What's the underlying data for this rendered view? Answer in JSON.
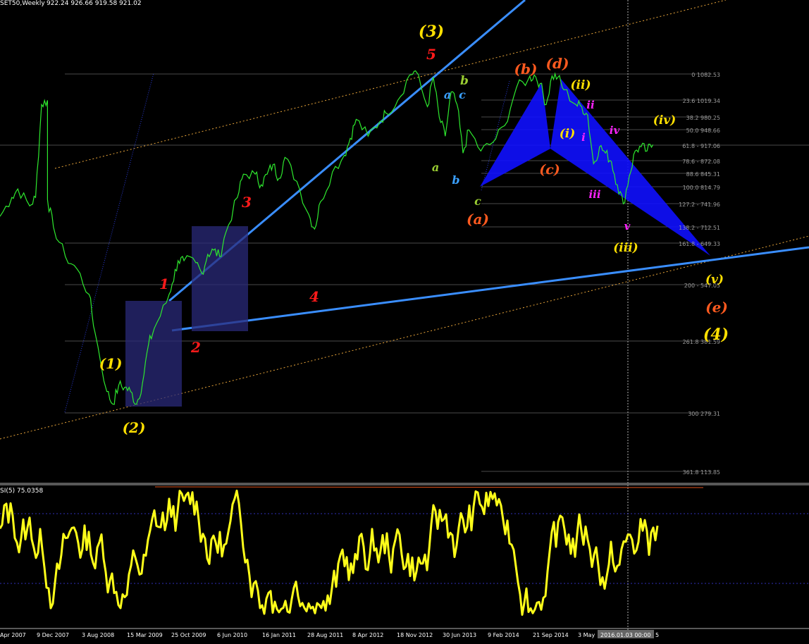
{
  "chart_data": {
    "type": "line",
    "header": {
      "symbol_text": "SET50,Weekly",
      "ohlc_text": "922.24 926.66 919.58 921.02"
    },
    "fibonacci_levels": [
      {
        "label": "0 1082.53"
      },
      {
        "label": "23.6 1019.34"
      },
      {
        "label": "38.2 980.25"
      },
      {
        "label": "50.0 948.66"
      },
      {
        "label": "61.8 - 917.06"
      },
      {
        "label": "78.6 - 872.08"
      },
      {
        "label": "88.6 845.31"
      },
      {
        "label": "100.0 814.79"
      },
      {
        "label": "127.2 - 741.96"
      },
      {
        "label": "138.2 - 712.51"
      },
      {
        "label": "161.8 - 649.33"
      },
      {
        "label": "200 - 547.05"
      },
      {
        "label": "261.8 381.59"
      },
      {
        "label": "300 279.31"
      },
      {
        "label": "361.8 113.85"
      }
    ],
    "x_tick_labels": [
      "Apr 2007",
      "9 Dec 2007",
      "3 Aug 2008",
      "15 Mar 2009",
      "25 Oct 2009",
      "6 Jun 2010",
      "16 Jan 2011",
      "28 Aug 2011",
      "8 Apr 2012",
      "18 Nov 2012",
      "30 Jun 2013",
      "9 Feb 2014",
      "21 Sep 2014",
      "3 May",
      "2016.01.03 00:00",
      "5"
    ],
    "wave_labels": [
      {
        "text": "(3)",
        "color": "#ffe000"
      },
      {
        "text": "5",
        "color": "#ff1a1a"
      },
      {
        "text": "(b)",
        "color": "#ff5a1f"
      },
      {
        "text": "(d)",
        "color": "#ff5a1f"
      },
      {
        "text": "(ii)",
        "color": "#ffe000"
      },
      {
        "text": "b",
        "color": "#9acd32"
      },
      {
        "text": "a",
        "color": "#3aa0ff"
      },
      {
        "text": "c",
        "color": "#3aa0ff"
      },
      {
        "text": "ii",
        "color": "#ff22ff"
      },
      {
        "text": "iv",
        "color": "#ff22ff"
      },
      {
        "text": "(iv)",
        "color": "#ffe000"
      },
      {
        "text": "(i)",
        "color": "#ffe000"
      },
      {
        "text": "i",
        "color": "#ff22ff"
      },
      {
        "text": "a",
        "color": "#9acd32"
      },
      {
        "text": "b",
        "color": "#3aa0ff"
      },
      {
        "text": "(c)",
        "color": "#ff5a1f"
      },
      {
        "text": "c",
        "color": "#9acd32"
      },
      {
        "text": "(a)",
        "color": "#ff5a1f"
      },
      {
        "text": "iii",
        "color": "#ff22ff"
      },
      {
        "text": "v",
        "color": "#ff22ff"
      },
      {
        "text": "(iii)",
        "color": "#ffe000"
      },
      {
        "text": "3",
        "color": "#ff1a1a"
      },
      {
        "text": "1",
        "color": "#ff1a1a"
      },
      {
        "text": "4",
        "color": "#ff1a1a"
      },
      {
        "text": "2",
        "color": "#ff1a1a"
      },
      {
        "text": "(1)",
        "color": "#ffe000"
      },
      {
        "text": "(2)",
        "color": "#ffe000"
      },
      {
        "text": "(v)",
        "color": "#ffe000"
      },
      {
        "text": "(e)",
        "color": "#ff5a1f"
      },
      {
        "text": "(4)",
        "color": "#ffe000"
      }
    ],
    "price_series": {
      "color": "#2ee82e",
      "points": [
        [
          "Apr 2007",
          745
        ],
        [
          "Jun 2007",
          790
        ],
        [
          "Jul 2007",
          810
        ],
        [
          "Sep 2007",
          770
        ],
        [
          "Oct 2007",
          790
        ],
        [
          "Nov 2007",
          1010
        ],
        [
          "Dec 2007",
          1020
        ],
        [
          "Dec 2007",
          785
        ],
        [
          "Jan 2008",
          720
        ],
        [
          "Mar 2008",
          650
        ],
        [
          "May 2008",
          620
        ],
        [
          "Jul 2008",
          560
        ],
        [
          "Aug 2008",
          470
        ],
        [
          "Oct 2008",
          330
        ],
        [
          "Nov 2008",
          300
        ],
        [
          "Dec 2008",
          345
        ],
        [
          "Jan 2009",
          340
        ],
        [
          "Feb 2009",
          330
        ],
        [
          "Mar 2009",
          300
        ],
        [
          "Apr 2009",
          350
        ],
        [
          "May 2009",
          440
        ],
        [
          "Jun 2009",
          480
        ],
        [
          "Aug 2009",
          540
        ],
        [
          "Sep 2009",
          585
        ],
        [
          "Oct 2009",
          640
        ],
        [
          "Nov 2009",
          640
        ],
        [
          "Jan 2010",
          635
        ],
        [
          "Feb 2010",
          610
        ],
        [
          "Mar 2010",
          655
        ],
        [
          "Apr 2010",
          665
        ],
        [
          "May 2010",
          650
        ],
        [
          "Jun 2010",
          705
        ],
        [
          "Aug 2010",
          790
        ],
        [
          "Sep 2010",
          845
        ],
        [
          "Nov 2010",
          845
        ],
        [
          "Dec 2010",
          820
        ],
        [
          "Jan 2011",
          845
        ],
        [
          "Feb 2011",
          868
        ],
        [
          "Mar 2011",
          835
        ],
        [
          "Apr 2011",
          885
        ],
        [
          "Jun 2011",
          828
        ],
        [
          "Aug 2011",
          750
        ],
        [
          "Sep 2011",
          715
        ],
        [
          "Oct 2011",
          780
        ],
        [
          "Dec 2011",
          850
        ],
        [
          "Feb 2012",
          890
        ],
        [
          "Mar 2012",
          930
        ],
        [
          "Apr 2012",
          975
        ],
        [
          "Jun 2012",
          935
        ],
        [
          "Aug 2012",
          970
        ],
        [
          "Sep 2012",
          990
        ],
        [
          "Nov 2012",
          1020
        ],
        [
          "Jan 2013",
          1080
        ],
        [
          "Feb 2013",
          1090
        ],
        [
          "Apr 2013",
          1005
        ],
        [
          "May 2013",
          1075
        ],
        [
          "Jun 2013",
          980
        ],
        [
          "Jul 2013",
          935
        ],
        [
          "Aug 2013",
          1040
        ],
        [
          "Sep 2013",
          1010
        ],
        [
          "Oct 2013",
          895
        ],
        [
          "Nov 2013",
          950
        ],
        [
          "Jan 2014",
          900
        ],
        [
          "Mar 2014",
          920
        ],
        [
          "May 2014",
          960
        ],
        [
          "Jul 2014",
          1050
        ],
        [
          "Sep 2014",
          1070
        ],
        [
          "Oct 2014",
          1080
        ],
        [
          "Nov 2014",
          1060
        ],
        [
          "Dec 2014",
          1010
        ],
        [
          "Jan 2015",
          1078
        ],
        [
          "Feb 2015",
          1075
        ],
        [
          "Mar 2015",
          1045
        ],
        [
          "May 2015",
          1010
        ],
        [
          "Jun 2015",
          1005
        ],
        [
          "Jul 2015",
          985
        ],
        [
          "Aug 2015",
          870
        ],
        [
          "Sep 2015",
          910
        ],
        [
          "Oct 2015",
          895
        ],
        [
          "Nov 2015",
          875
        ],
        [
          "Dec 2015",
          820
        ],
        [
          "Jan 2016",
          775
        ],
        [
          "Feb 2016",
          840
        ],
        [
          "Mar 2016",
          900
        ],
        [
          "Apr 2016",
          910
        ],
        [
          "May 2016",
          900
        ],
        [
          "Jun 2016",
          915
        ]
      ]
    },
    "rsi": {
      "label": "SI(5) 75.0358",
      "color": "#ffff1a",
      "levels": [
        70,
        30
      ],
      "ylim": [
        0,
        100
      ]
    }
  }
}
